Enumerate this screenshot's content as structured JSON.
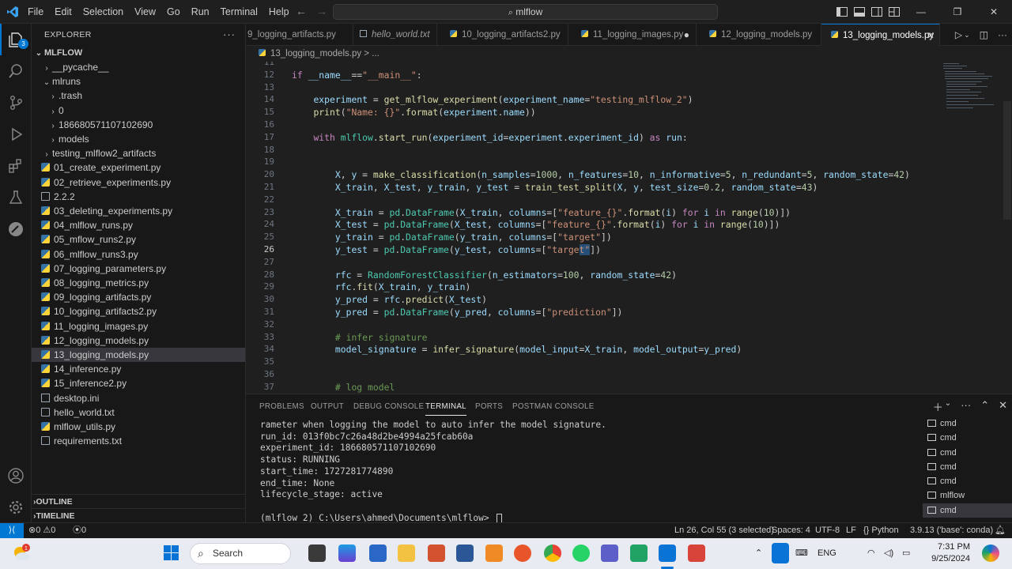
{
  "window": {
    "menu": [
      "File",
      "Edit",
      "Selection",
      "View",
      "Go",
      "Run",
      "Terminal",
      "Help"
    ],
    "search": "mlflow"
  },
  "explorer": {
    "title": "EXPLORER",
    "root": "MLFLOW",
    "items": [
      {
        "label": "__pycache__",
        "kind": "folder",
        "depth": 1
      },
      {
        "label": "mlruns",
        "kind": "folder-open",
        "depth": 1
      },
      {
        "label": ".trash",
        "kind": "folder",
        "depth": 2
      },
      {
        "label": "0",
        "kind": "folder",
        "depth": 2
      },
      {
        "label": "186680571107102690",
        "kind": "folder",
        "depth": 2
      },
      {
        "label": "models",
        "kind": "folder",
        "depth": 2
      },
      {
        "label": "testing_mlflow2_artifacts",
        "kind": "folder",
        "depth": 1
      },
      {
        "label": "01_create_experiment.py",
        "kind": "py",
        "depth": 1
      },
      {
        "label": "02_retrieve_experiments.py",
        "kind": "py",
        "depth": 1
      },
      {
        "label": "2.2.2",
        "kind": "txt",
        "depth": 1
      },
      {
        "label": "03_deleting_experiments.py",
        "kind": "py",
        "depth": 1
      },
      {
        "label": "04_mlflow_runs.py",
        "kind": "py",
        "depth": 1
      },
      {
        "label": "05_mflow_runs2.py",
        "kind": "py",
        "depth": 1
      },
      {
        "label": "06_mlflow_runs3.py",
        "kind": "py",
        "depth": 1
      },
      {
        "label": "07_logging_parameters.py",
        "kind": "py",
        "depth": 1
      },
      {
        "label": "08_logging_metrics.py",
        "kind": "py",
        "depth": 1
      },
      {
        "label": "09_logging_artifacts.py",
        "kind": "py",
        "depth": 1
      },
      {
        "label": "10_logging_artifacts2.py",
        "kind": "py",
        "depth": 1
      },
      {
        "label": "11_logging_images.py",
        "kind": "py",
        "depth": 1
      },
      {
        "label": "12_logging_models.py",
        "kind": "py",
        "depth": 1
      },
      {
        "label": "13_logging_models.py",
        "kind": "py",
        "depth": 1,
        "selected": true
      },
      {
        "label": "14_inference.py",
        "kind": "py",
        "depth": 1
      },
      {
        "label": "15_inference2.py",
        "kind": "py",
        "depth": 1
      },
      {
        "label": "desktop.ini",
        "kind": "ini",
        "depth": 1
      },
      {
        "label": "hello_world.txt",
        "kind": "txt",
        "depth": 1
      },
      {
        "label": "mlflow_utils.py",
        "kind": "py",
        "depth": 1
      },
      {
        "label": "requirements.txt",
        "kind": "txt",
        "depth": 1
      }
    ],
    "outline": "OUTLINE",
    "timeline": "TIMELINE"
  },
  "tabs": [
    {
      "label": "9_logging_artifacts.py",
      "kind": "py"
    },
    {
      "label": "hello_world.txt",
      "kind": "txt"
    },
    {
      "label": "10_logging_artifacts2.py",
      "kind": "py"
    },
    {
      "label": "11_logging_images.py",
      "kind": "py",
      "dirty": true
    },
    {
      "label": "12_logging_models.py",
      "kind": "py"
    },
    {
      "label": "13_logging_models.py",
      "kind": "py",
      "active": true
    }
  ],
  "breadcrumb": "13_logging_models.py > ...",
  "editor": {
    "current_line": 26,
    "lines": [
      {
        "n": "11",
        "html": ""
      },
      {
        "n": "12",
        "html": "<span class='kw'>if</span> <span class='vr'>__name__</span>==<span class='st'>\"__main__\"</span>:"
      },
      {
        "n": "13",
        "html": ""
      },
      {
        "n": "14",
        "html": "    <span class='vr'>experiment</span> = <span class='fn'>get_mlflow_experiment</span>(<span class='vr'>experiment_name</span>=<span class='st'>\"testing_mlflow_2\"</span>)"
      },
      {
        "n": "15",
        "html": "    <span class='fn'>print</span>(<span class='st'>\"Name: {}\"</span>.<span class='fn'>format</span>(<span class='vr'>experiment</span>.<span class='vr'>name</span>))"
      },
      {
        "n": "16",
        "html": ""
      },
      {
        "n": "17",
        "html": "    <span class='kw'>with</span> <span class='cl'>mlflow</span>.<span class='fn'>start_run</span>(<span class='vr'>experiment_id</span>=<span class='vr'>experiment</span>.<span class='vr'>experiment_id</span>) <span class='kw'>as</span> <span class='vr'>run</span>:"
      },
      {
        "n": "18",
        "html": ""
      },
      {
        "n": "19",
        "html": ""
      },
      {
        "n": "20",
        "html": "        <span class='vr'>X</span>, <span class='vr'>y</span> = <span class='fn'>make_classification</span>(<span class='vr'>n_samples</span>=<span class='nm'>1000</span>, <span class='vr'>n_features</span>=<span class='nm'>10</span>, <span class='vr'>n_informative</span>=<span class='nm'>5</span>, <span class='vr'>n_redundant</span>=<span class='nm'>5</span>, <span class='vr'>random_state</span>=<span class='nm'>42</span>)"
      },
      {
        "n": "21",
        "html": "        <span class='vr'>X_train</span>, <span class='vr'>X_test</span>, <span class='vr'>y_train</span>, <span class='vr'>y_test</span> = <span class='fn'>train_test_split</span>(<span class='vr'>X</span>, <span class='vr'>y</span>, <span class='vr'>test_size</span>=<span class='nm'>0.2</span>, <span class='vr'>random_state</span>=<span class='nm'>43</span>)"
      },
      {
        "n": "22",
        "html": ""
      },
      {
        "n": "23",
        "html": "        <span class='vr'>X_train</span> = <span class='cl'>pd</span>.<span class='cl'>DataFrame</span>(<span class='vr'>X_train</span>, <span class='vr'>columns</span>=[<span class='st'>\"feature_{}\"</span>.<span class='fn'>format</span>(<span class='vr'>i</span>) <span class='kw'>for</span> <span class='vr'>i</span> <span class='kw'>in</span> <span class='fn'>range</span>(<span class='nm'>10</span>)])"
      },
      {
        "n": "24",
        "html": "        <span class='vr'>X_test</span> = <span class='cl'>pd</span>.<span class='cl'>DataFrame</span>(<span class='vr'>X_test</span>, <span class='vr'>columns</span>=[<span class='st'>\"feature_{}\"</span>.<span class='fn'>format</span>(<span class='vr'>i</span>) <span class='kw'>for</span> <span class='vr'>i</span> <span class='kw'>in</span> <span class='fn'>range</span>(<span class='nm'>10</span>)])"
      },
      {
        "n": "25",
        "html": "        <span class='vr'>y_train</span> = <span class='cl'>pd</span>.<span class='cl'>DataFrame</span>(<span class='vr'>y_train</span>, <span class='vr'>columns</span>=[<span class='st'>\"target\"</span>])"
      },
      {
        "n": "26",
        "html": "        <span class='vr'>y_test</span> = <span class='cl'>pd</span>.<span class='cl'>DataFrame</span>(<span class='vr'>y_test</span>, <span class='vr'>columns</span>=[<span class='st'>\"targe<span style='background:#264f78'>t\"</span></span>])"
      },
      {
        "n": "27",
        "html": ""
      },
      {
        "n": "28",
        "html": "        <span class='vr'>rfc</span> = <span class='cl'>RandomForestClassifier</span>(<span class='vr'>n_estimators</span>=<span class='nm'>100</span>, <span class='vr'>random_state</span>=<span class='nm'>42</span>)"
      },
      {
        "n": "29",
        "html": "        <span class='vr'>rfc</span>.<span class='fn'>fit</span>(<span class='vr'>X_train</span>, <span class='vr'>y_train</span>)"
      },
      {
        "n": "30",
        "html": "        <span class='vr'>y_pred</span> = <span class='vr'>rfc</span>.<span class='fn'>predict</span>(<span class='vr'>X_test</span>)"
      },
      {
        "n": "31",
        "html": "        <span class='vr'>y_pred</span> = <span class='cl'>pd</span>.<span class='cl'>DataFrame</span>(<span class='vr'>y_pred</span>, <span class='vr'>columns</span>=[<span class='st'>\"prediction\"</span>])"
      },
      {
        "n": "32",
        "html": ""
      },
      {
        "n": "33",
        "html": "        <span class='cm'># infer signature</span>"
      },
      {
        "n": "34",
        "html": "        <span class='vr'>model_signature</span> = <span class='fn'>infer_signature</span>(<span class='vr'>model_input</span>=<span class='vr'>X_train</span>, <span class='vr'>model_output</span>=<span class='vr'>y_pred</span>)"
      },
      {
        "n": "35",
        "html": ""
      },
      {
        "n": "36",
        "html": ""
      },
      {
        "n": "37",
        "html": "        <span class='cm'># log model</span>"
      }
    ]
  },
  "panel": {
    "tabs": [
      "PROBLEMS",
      "OUTPUT",
      "DEBUG CONSOLE",
      "TERMINAL",
      "PORTS",
      "POSTMAN CONSOLE"
    ],
    "active_tab": "TERMINAL",
    "terminal_lines": [
      "rameter when logging the model to auto infer the model signature.",
      "run_id: 013f0bc7c26a48d2be4994a25fcab60a",
      "experiment_id: 186680571107102690",
      "status: RUNNING",
      "start_time: 1727281774890",
      "end_time: None",
      "lifecycle_stage: active",
      "",
      "(mlflow_2) C:\\Users\\ahmed\\Documents\\mlflow>"
    ],
    "terminals": [
      "cmd",
      "cmd",
      "cmd",
      "cmd",
      "cmd",
      "mlflow",
      "cmd"
    ]
  },
  "statusbar": {
    "problems_errors": "0",
    "problems_warnings": "0",
    "ports": "0",
    "position": "Ln 26, Col 55 (3 selected)",
    "spaces": "Spaces: 4",
    "encoding": "UTF-8",
    "eol": "LF",
    "language": "Python",
    "interpreter": "3.9.13 ('base': conda)"
  },
  "taskbar": {
    "search": "Search",
    "lang": "ENG",
    "time": "7:31 PM",
    "date": "9/25/2024"
  }
}
